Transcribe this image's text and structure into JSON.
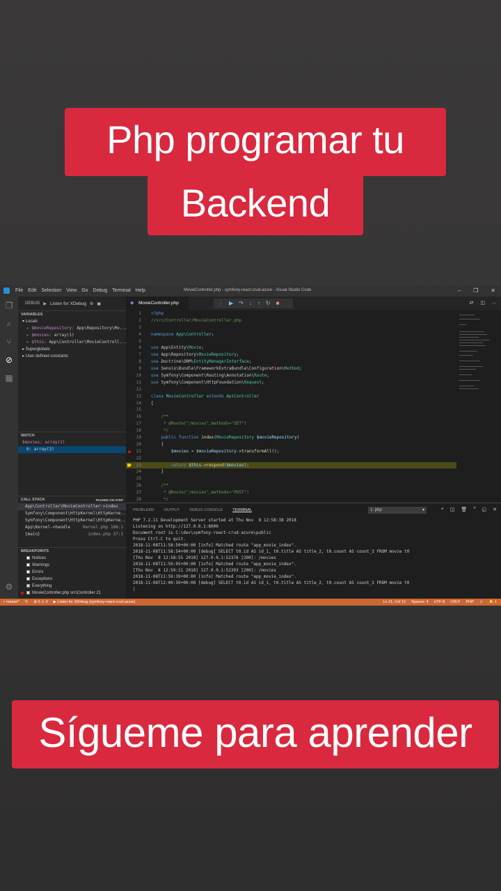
{
  "captions": {
    "top_line1": "Php programar tu",
    "top_line2": "Backend",
    "bottom": "Sígueme para aprender"
  },
  "window": {
    "title": "MovieController.php - symfony-react-crud-azure - Visual Studio Code",
    "menu": [
      "File",
      "Edit",
      "Selection",
      "View",
      "Go",
      "Debug",
      "Terminal",
      "Help"
    ]
  },
  "debug": {
    "label": "DEBUG",
    "config": "Listen for XDebug"
  },
  "variables": {
    "title": "VARIABLES",
    "locals": "Locals",
    "items": [
      {
        "name": "$movieRepository:",
        "value": "App\\Repository\\Mo..."
      },
      {
        "name": "$movies:",
        "value": "array(1)"
      },
      {
        "name": "$this:",
        "value": "App\\Controller\\MovieControll..."
      }
    ],
    "superglobals": "Superglobals",
    "user_defined": "User defined constants"
  },
  "watch": {
    "title": "WATCH",
    "items": [
      "$movies: array(1)",
      "0: array(3)"
    ]
  },
  "callstack": {
    "title": "CALL STACK",
    "status": "PAUSED ON STEP",
    "items": [
      {
        "fn": "App\\Controller\\MovieController->index",
        "file": ""
      },
      {
        "fn": "Symfony\\Component\\HttpKernel\\HttpKerne...",
        "file": ""
      },
      {
        "fn": "Symfony\\Component\\HttpKernel\\HttpKerne...",
        "file": ""
      },
      {
        "fn": "App\\Kernel->handle",
        "file": "Kernel.php 188:1"
      },
      {
        "fn": "{main}",
        "file": "index.php 37:1"
      }
    ]
  },
  "breakpoints": {
    "title": "BREAKPOINTS",
    "items": [
      {
        "label": "Notices",
        "checked": false
      },
      {
        "label": "Warnings",
        "checked": false
      },
      {
        "label": "Errors",
        "checked": false
      },
      {
        "label": "Exceptions",
        "checked": false
      },
      {
        "label": "Everything",
        "checked": true
      },
      {
        "label": "MovieController.php  src\\Controller   21",
        "checked": true
      }
    ]
  },
  "tab": {
    "filename": "MovieController.php"
  },
  "code_lines": [
    {
      "n": "1",
      "html": "<span class='k'>&lt;?php</span>"
    },
    {
      "n": "2",
      "html": "<span class='c'>//src/Controller/MovieController.php</span>"
    },
    {
      "n": "3",
      "html": ""
    },
    {
      "n": "4",
      "html": "<span class='k'>namespace</span> <span class='t'>App\\Controller</span>;"
    },
    {
      "n": "5",
      "html": ""
    },
    {
      "n": "6",
      "html": "<span class='k'>use</span> App\\Entity\\<span class='t'>Movie</span>;"
    },
    {
      "n": "7",
      "html": "<span class='k'>use</span> App\\Repository\\<span class='t'>MovieRepository</span>;"
    },
    {
      "n": "8",
      "html": "<span class='k'>use</span> Doctrine\\ORM\\<span class='t'>EntityManagerInterface</span>;"
    },
    {
      "n": "9",
      "html": "<span class='k'>use</span> Sensio\\Bundle\\FrameworkExtraBundle\\Configuration\\<span class='t'>Method</span>;"
    },
    {
      "n": "10",
      "html": "<span class='k'>use</span> Symfony\\Component\\Routing\\Annotation\\<span class='t'>Route</span>;"
    },
    {
      "n": "11",
      "html": "<span class='k'>use</span> Symfony\\Component\\HttpFoundation\\<span class='t'>Request</span>;"
    },
    {
      "n": "12",
      "html": ""
    },
    {
      "n": "13",
      "html": "<span class='k'>class</span> <span class='t'>MovieController</span> <span class='k'>extends</span> <span class='t'>ApiController</span>"
    },
    {
      "n": "14",
      "html": "{"
    },
    {
      "n": "15",
      "html": ""
    },
    {
      "n": "16",
      "html": "    <span class='c'>/**</span>"
    },
    {
      "n": "17",
      "html": "    <span class='c'> * @Route(\"/movies\",methods=\"GET\")</span>"
    },
    {
      "n": "18",
      "html": "    <span class='c'> */</span>"
    },
    {
      "n": "19",
      "html": "    <span class='k'>public function</span> <span class='f'>index</span>(<span class='t'>MovieRepository</span> <span class='v'>$movieRepository</span>)"
    },
    {
      "n": "20",
      "html": "    {"
    },
    {
      "n": "21",
      "html": "        <span class='v'>$movies</span> = <span class='v'>$movieRepository</span>-&gt;<span class='f'>transformAll</span>();",
      "bp": true
    },
    {
      "n": "22",
      "html": ""
    },
    {
      "n": "23",
      "html": "        <span class='k'>return</span> <span class='v'>$this</span>-&gt;<span class='f'>respond</span>(<span class='v'>$movies</span>);",
      "current": true
    },
    {
      "n": "24",
      "html": "    }"
    },
    {
      "n": "25",
      "html": ""
    },
    {
      "n": "26",
      "html": "    <span class='c'>/**</span>"
    },
    {
      "n": "27",
      "html": "    <span class='c'> * @Route(\"/movies\",methods=\"POST\")</span>"
    },
    {
      "n": "28",
      "html": "    <span class='c'> */</span>"
    }
  ],
  "panel": {
    "tabs": [
      "PROBLEMS",
      "OUTPUT",
      "DEBUG CONSOLE",
      "TERMINAL"
    ],
    "active": "TERMINAL",
    "terminal_select": "1: php",
    "lines": [
      "PHP 7.2.11 Development Server started at Thu Nov  8 12:58:38 2018",
      "Listening on http://127.0.0.1:8000",
      "Document root is C:\\dev\\symfony-react-crud-azure\\public",
      "Press Ctrl-C to quit.",
      "2018-11-08T11:58:50+00:00 [info] Matched route \"app_movie_index\".",
      "2018-11-08T11:58:54+00:00 [debug] SELECT t0.id AS id_1, t0.title AS title_2, t0.count AS count_3 FROM movie t0",
      "[Thu Nov  8 12:58:55 2018] 127.0.0.1:52376 [200]: /movies",
      "2018-11-08T11:59:05+00:00 [info] Matched route \"app_movie_index\".",
      "[Thu Nov  8 12:59:11 2018] 127.0.0.1:52393 [200]: /movies",
      "2018-11-08T11:59:39+00:00 [info] Matched route \"app_movie_index\".",
      "2018-11-08T12:00:50+00:00 [debug] SELECT t0.id AS id_1, t0.title AS title_2, t0.count AS count_3 FROM movie t0",
      "|"
    ]
  },
  "status": {
    "branch": "master*",
    "errors": "0",
    "warnings": "0",
    "debug": "Listen for XDebug (symfony-react-crud-azure)",
    "position": "Ln 21, Col 12",
    "spaces": "Spaces: 4",
    "encoding": "UTF-8",
    "eol": "CRLF",
    "language": "PHP",
    "notifications": "1"
  }
}
